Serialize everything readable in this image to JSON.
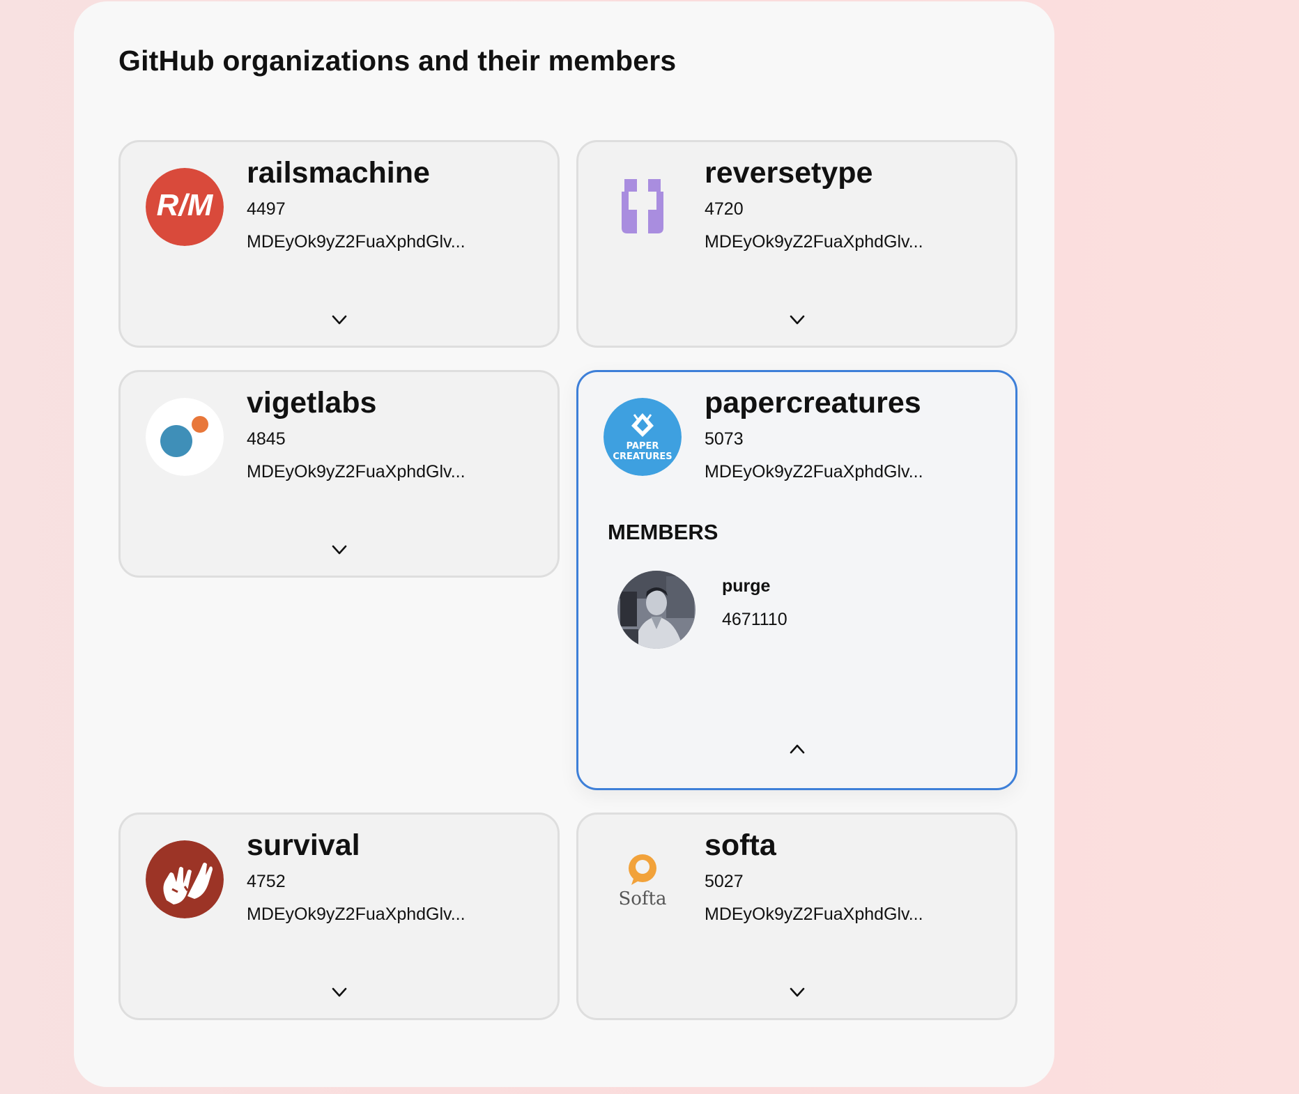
{
  "page": {
    "title": "GitHub organizations and their members"
  },
  "organizations": [
    {
      "login": "railsmachine",
      "id": "4497",
      "node_id": "MDEyOk9yZ2FuaXphdGlv...",
      "avatar_icon": "railsmachine-logo",
      "expanded": false
    },
    {
      "login": "reversetype",
      "id": "4720",
      "node_id": "MDEyOk9yZ2FuaXphdGlv...",
      "avatar_icon": "reversetype-logo",
      "expanded": false
    },
    {
      "login": "vigetlabs",
      "id": "4845",
      "node_id": "MDEyOk9yZ2FuaXphdGlv...",
      "avatar_icon": "vigetlabs-logo",
      "expanded": false
    },
    {
      "login": "papercreatures",
      "id": "5073",
      "node_id": "MDEyOk9yZ2FuaXphdGlv...",
      "avatar_icon": "papercreatures-logo",
      "logo_text_line1": "PAPER",
      "logo_text_line2": "CREATURES",
      "expanded": true,
      "members_label": "MEMBERS",
      "members": [
        {
          "login": "purge",
          "id": "4671110",
          "avatar_icon": "user-photo"
        }
      ]
    },
    {
      "login": "survival",
      "id": "4752",
      "node_id": "MDEyOk9yZ2FuaXphdGlv...",
      "avatar_icon": "survival-logo",
      "expanded": false
    },
    {
      "login": "softa",
      "id": "5027",
      "node_id": "MDEyOk9yZ2FuaXphdGlv...",
      "avatar_icon": "softa-logo",
      "logo_text": "Softa",
      "expanded": false
    }
  ],
  "colors": {
    "accent_border": "#3d7fd8",
    "railsmachine": "#d94a3b",
    "reversetype": "#a98ddf",
    "vigetlabs_blue": "#3f8fb8",
    "vigetlabs_orange": "#e8773a",
    "papercreatures": "#3ea0e0",
    "survival": "#9c3426",
    "softa_orange": "#f2a23a"
  },
  "icons": {
    "collapsed_toggle": "chevron-down-icon",
    "expanded_toggle": "chevron-up-icon"
  }
}
